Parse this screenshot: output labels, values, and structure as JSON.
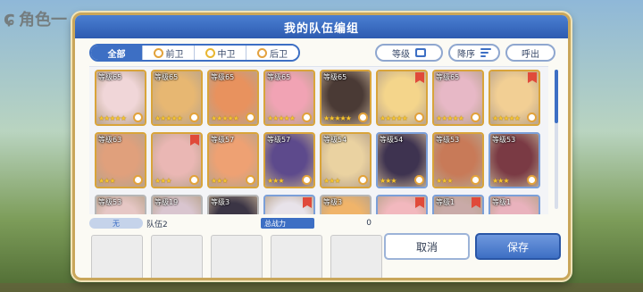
{
  "background": {
    "title": "角色一"
  },
  "dialog": {
    "title": "我的队伍编组"
  },
  "filters": {
    "tabs": [
      {
        "label": "全部",
        "active": true
      },
      {
        "label": "前卫",
        "active": false
      },
      {
        "label": "中卫",
        "active": false
      },
      {
        "label": "后卫",
        "active": false
      }
    ],
    "sort_key": "等级",
    "sort_order": "降序",
    "callout": "呼出"
  },
  "characters": [
    {
      "level": "等级65",
      "stars": "★★★★★",
      "frame": "gold",
      "flag": false,
      "color": "#f0d6d8"
    },
    {
      "level": "等级65",
      "stars": "★★★★★",
      "frame": "gold",
      "flag": false,
      "color": "#e7b772"
    },
    {
      "level": "等级65",
      "stars": "★★★★★",
      "frame": "gold",
      "flag": false,
      "color": "#e8925e"
    },
    {
      "level": "等级65",
      "stars": "★★★★★",
      "frame": "gold",
      "flag": false,
      "color": "#f1a3b4"
    },
    {
      "level": "等级65",
      "stars": "★★★★★",
      "frame": "gold",
      "flag": false,
      "color": "#4a3a35"
    },
    {
      "level": "",
      "stars": "★★★★★",
      "frame": "gold",
      "flag": true,
      "color": "#f4d58b"
    },
    {
      "level": "等级65",
      "stars": "★★★★★",
      "frame": "gold",
      "flag": false,
      "color": "#e7b8c6"
    },
    {
      "level": "",
      "stars": "★★★★★",
      "frame": "gold",
      "flag": true,
      "color": "#f2cf94"
    },
    {
      "level": "等级63",
      "stars": "★★★",
      "frame": "gold",
      "flag": false,
      "color": "#e0a07c"
    },
    {
      "level": "",
      "stars": "★★★",
      "frame": "gold",
      "flag": true,
      "color": "#eab7b4"
    },
    {
      "level": "等级57",
      "stars": "★★★",
      "frame": "gold",
      "flag": false,
      "color": "#eea173"
    },
    {
      "level": "等级57",
      "stars": "★★★",
      "frame": "gold",
      "flag": false,
      "color": "#5d4a8c"
    },
    {
      "level": "等级54",
      "stars": "★★★",
      "frame": "gold",
      "flag": false,
      "color": "#ead2a1"
    },
    {
      "level": "等级54",
      "stars": "★★★",
      "frame": "blue",
      "flag": false,
      "color": "#3e3350"
    },
    {
      "level": "等级53",
      "stars": "★★★",
      "frame": "gold",
      "flag": false,
      "color": "#c87a58"
    },
    {
      "level": "等级53",
      "stars": "★★★",
      "frame": "blue",
      "flag": false,
      "color": "#7a3a44"
    },
    {
      "level": "等级53",
      "stars": "",
      "frame": "gray",
      "flag": false,
      "color": "#e6c7c5"
    },
    {
      "level": "等级19",
      "stars": "",
      "frame": "gray",
      "flag": false,
      "color": "#d9c5cf"
    },
    {
      "level": "等级3",
      "stars": "",
      "frame": "gray",
      "flag": false,
      "color": "#3b3545"
    },
    {
      "level": "",
      "stars": "",
      "frame": "blue",
      "flag": true,
      "color": "#e8e3ea"
    },
    {
      "level": "等级3",
      "stars": "",
      "frame": "gray",
      "flag": false,
      "color": "#f0b46a"
    },
    {
      "level": "",
      "stars": "",
      "frame": "blue",
      "flag": true,
      "color": "#f2b8be"
    },
    {
      "level": "等级1",
      "stars": "",
      "frame": "blue",
      "flag": true,
      "color": "#c9aaa8"
    },
    {
      "level": "等级1",
      "stars": "",
      "frame": "blue",
      "flag": false,
      "color": "#e9b2bd"
    }
  ],
  "team": {
    "label": "无",
    "name": "队伍2",
    "power_label": "总战力",
    "power_value": "0"
  },
  "buttons": {
    "cancel": "取消",
    "save": "保存"
  }
}
